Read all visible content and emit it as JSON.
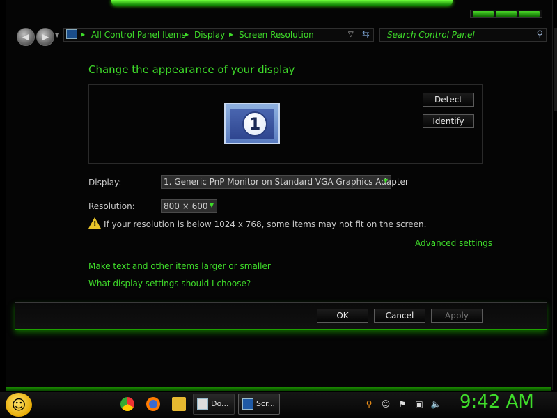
{
  "nav": {
    "back_icon": "arrow-left-icon",
    "forward_icon": "arrow-right-icon",
    "breadcrumbs": [
      "All Control Panel Items",
      "Display",
      "Screen Resolution"
    ]
  },
  "search": {
    "placeholder": "Search Control Panel"
  },
  "main": {
    "heading": "Change the appearance of your display",
    "monitor_number": "1",
    "detect_label": "Detect",
    "identify_label": "Identify",
    "display_label": "Display:",
    "display_value": "1. Generic PnP Monitor on Standard VGA Graphics Adapter",
    "resolution_label": "Resolution:",
    "resolution_value": "800 × 600",
    "warning_text": "If your resolution is below 1024 x 768, some items may not fit on the screen.",
    "advanced_link": "Advanced settings",
    "larger_link": "Make text and other items larger or smaller",
    "help_link": "What display settings should I choose?"
  },
  "footer": {
    "ok": "OK",
    "cancel": "Cancel",
    "apply": "Apply"
  },
  "taskbar": {
    "tasks": [
      {
        "label": "Do...",
        "icon": "document-icon"
      },
      {
        "label": "Scr...",
        "icon": "display-icon"
      }
    ],
    "clock": "9:42 AM"
  },
  "colors": {
    "accent": "#3fdc2a",
    "background": "#000000"
  }
}
